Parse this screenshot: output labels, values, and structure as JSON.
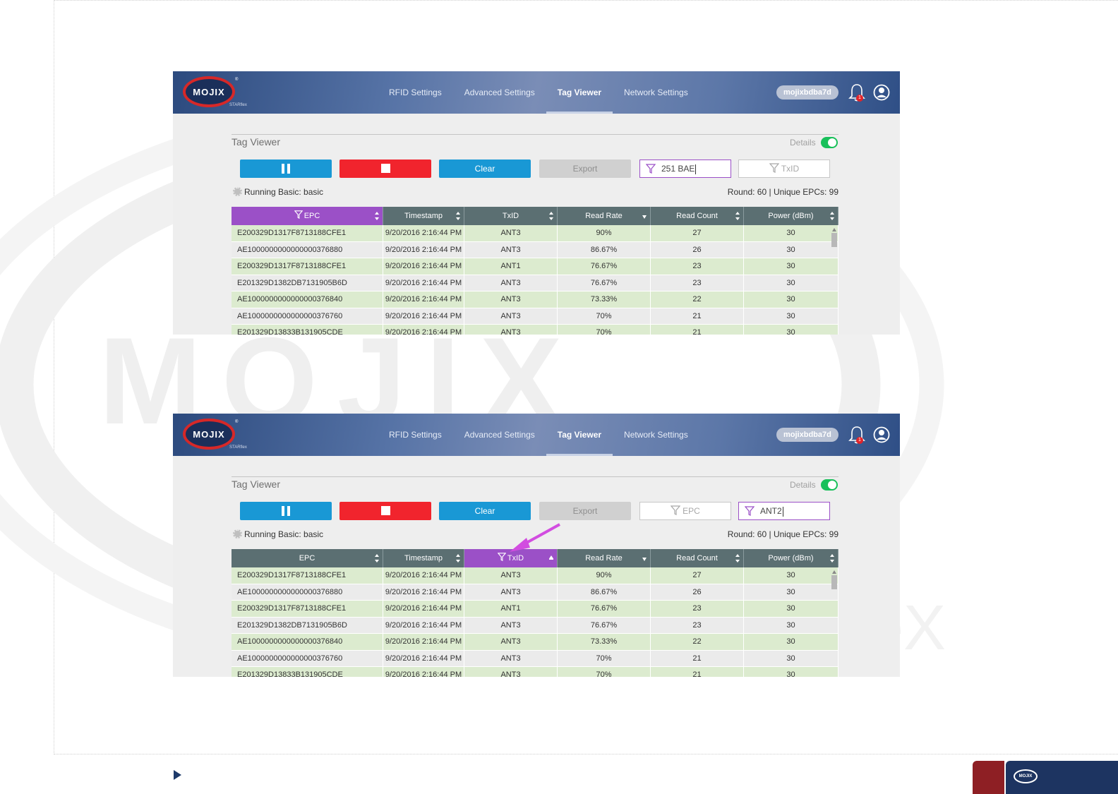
{
  "nav": {
    "logo_text": "MOJIX",
    "logo_sub": "STARflex",
    "logo_reg": "®",
    "tabs": [
      "RFID Settings",
      "Advanced Settings",
      "Tag Viewer",
      "Network Settings"
    ],
    "active_tab": "Tag Viewer",
    "user": "mojixbdba7d",
    "notification_count": "1"
  },
  "panel": {
    "title": "Tag Viewer",
    "details_label": "Details",
    "details_on": true,
    "buttons": {
      "clear": "Clear",
      "export": "Export"
    },
    "status_left": "Running Basic: basic",
    "status_right": "Round: 60 | Unique EPCs: 99"
  },
  "columns": [
    "EPC",
    "Timestamp",
    "TxID",
    "Read Rate",
    "Read Count",
    "Power (dBm)"
  ],
  "rows": [
    [
      "E200329D1317F8713188CFE1",
      "9/20/2016 2:16:44 PM",
      "ANT3",
      "90%",
      "27",
      "30"
    ],
    [
      "AE1000000000000000376880",
      "9/20/2016 2:16:44 PM",
      "ANT3",
      "86.67%",
      "26",
      "30"
    ],
    [
      "E200329D1317F8713188CFE1",
      "9/20/2016 2:16:44 PM",
      "ANT1",
      "76.67%",
      "23",
      "30"
    ],
    [
      "E201329D1382DB7131905B6D",
      "9/20/2016 2:16:44 PM",
      "ANT3",
      "76.67%",
      "23",
      "30"
    ],
    [
      "AE1000000000000000376840",
      "9/20/2016 2:16:44 PM",
      "ANT3",
      "73.33%",
      "22",
      "30"
    ],
    [
      "AE1000000000000000376760",
      "9/20/2016 2:16:44 PM",
      "ANT3",
      "70%",
      "21",
      "30"
    ],
    [
      "E201329D13833B131905CDE",
      "9/20/2016 2:16:44 PM",
      "ANT3",
      "70%",
      "21",
      "30"
    ]
  ],
  "shot_top": {
    "epc_filter_value": "251 BAE",
    "txid_filter_placeholder": "TxID",
    "filtered_column": "EPC"
  },
  "shot_bottom": {
    "epc_filter_placeholder": "EPC",
    "txid_filter_value": "ANT2",
    "filtered_column": "TxID"
  },
  "watermark": "MOJIX",
  "watermark_suffix": "eX",
  "colors": {
    "nav": "#3f5d93",
    "filter_accent": "#9b50c7",
    "button_blue": "#1998d5",
    "button_red": "#f1242d",
    "row_green": "#dcebcf",
    "header_gray": "#5b6f72",
    "arrow": "#d24de0"
  }
}
